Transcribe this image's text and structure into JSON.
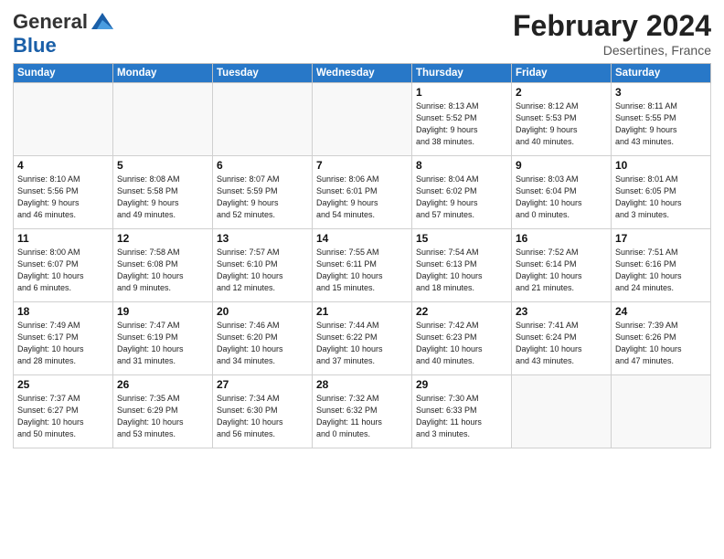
{
  "header": {
    "logo_general": "General",
    "logo_blue": "Blue",
    "month": "February 2024",
    "location": "Desertines, France"
  },
  "days_of_week": [
    "Sunday",
    "Monday",
    "Tuesday",
    "Wednesday",
    "Thursday",
    "Friday",
    "Saturday"
  ],
  "weeks": [
    [
      {
        "day": "",
        "info": ""
      },
      {
        "day": "",
        "info": ""
      },
      {
        "day": "",
        "info": ""
      },
      {
        "day": "",
        "info": ""
      },
      {
        "day": "1",
        "info": "Sunrise: 8:13 AM\nSunset: 5:52 PM\nDaylight: 9 hours\nand 38 minutes."
      },
      {
        "day": "2",
        "info": "Sunrise: 8:12 AM\nSunset: 5:53 PM\nDaylight: 9 hours\nand 40 minutes."
      },
      {
        "day": "3",
        "info": "Sunrise: 8:11 AM\nSunset: 5:55 PM\nDaylight: 9 hours\nand 43 minutes."
      }
    ],
    [
      {
        "day": "4",
        "info": "Sunrise: 8:10 AM\nSunset: 5:56 PM\nDaylight: 9 hours\nand 46 minutes."
      },
      {
        "day": "5",
        "info": "Sunrise: 8:08 AM\nSunset: 5:58 PM\nDaylight: 9 hours\nand 49 minutes."
      },
      {
        "day": "6",
        "info": "Sunrise: 8:07 AM\nSunset: 5:59 PM\nDaylight: 9 hours\nand 52 minutes."
      },
      {
        "day": "7",
        "info": "Sunrise: 8:06 AM\nSunset: 6:01 PM\nDaylight: 9 hours\nand 54 minutes."
      },
      {
        "day": "8",
        "info": "Sunrise: 8:04 AM\nSunset: 6:02 PM\nDaylight: 9 hours\nand 57 minutes."
      },
      {
        "day": "9",
        "info": "Sunrise: 8:03 AM\nSunset: 6:04 PM\nDaylight: 10 hours\nand 0 minutes."
      },
      {
        "day": "10",
        "info": "Sunrise: 8:01 AM\nSunset: 6:05 PM\nDaylight: 10 hours\nand 3 minutes."
      }
    ],
    [
      {
        "day": "11",
        "info": "Sunrise: 8:00 AM\nSunset: 6:07 PM\nDaylight: 10 hours\nand 6 minutes."
      },
      {
        "day": "12",
        "info": "Sunrise: 7:58 AM\nSunset: 6:08 PM\nDaylight: 10 hours\nand 9 minutes."
      },
      {
        "day": "13",
        "info": "Sunrise: 7:57 AM\nSunset: 6:10 PM\nDaylight: 10 hours\nand 12 minutes."
      },
      {
        "day": "14",
        "info": "Sunrise: 7:55 AM\nSunset: 6:11 PM\nDaylight: 10 hours\nand 15 minutes."
      },
      {
        "day": "15",
        "info": "Sunrise: 7:54 AM\nSunset: 6:13 PM\nDaylight: 10 hours\nand 18 minutes."
      },
      {
        "day": "16",
        "info": "Sunrise: 7:52 AM\nSunset: 6:14 PM\nDaylight: 10 hours\nand 21 minutes."
      },
      {
        "day": "17",
        "info": "Sunrise: 7:51 AM\nSunset: 6:16 PM\nDaylight: 10 hours\nand 24 minutes."
      }
    ],
    [
      {
        "day": "18",
        "info": "Sunrise: 7:49 AM\nSunset: 6:17 PM\nDaylight: 10 hours\nand 28 minutes."
      },
      {
        "day": "19",
        "info": "Sunrise: 7:47 AM\nSunset: 6:19 PM\nDaylight: 10 hours\nand 31 minutes."
      },
      {
        "day": "20",
        "info": "Sunrise: 7:46 AM\nSunset: 6:20 PM\nDaylight: 10 hours\nand 34 minutes."
      },
      {
        "day": "21",
        "info": "Sunrise: 7:44 AM\nSunset: 6:22 PM\nDaylight: 10 hours\nand 37 minutes."
      },
      {
        "day": "22",
        "info": "Sunrise: 7:42 AM\nSunset: 6:23 PM\nDaylight: 10 hours\nand 40 minutes."
      },
      {
        "day": "23",
        "info": "Sunrise: 7:41 AM\nSunset: 6:24 PM\nDaylight: 10 hours\nand 43 minutes."
      },
      {
        "day": "24",
        "info": "Sunrise: 7:39 AM\nSunset: 6:26 PM\nDaylight: 10 hours\nand 47 minutes."
      }
    ],
    [
      {
        "day": "25",
        "info": "Sunrise: 7:37 AM\nSunset: 6:27 PM\nDaylight: 10 hours\nand 50 minutes."
      },
      {
        "day": "26",
        "info": "Sunrise: 7:35 AM\nSunset: 6:29 PM\nDaylight: 10 hours\nand 53 minutes."
      },
      {
        "day": "27",
        "info": "Sunrise: 7:34 AM\nSunset: 6:30 PM\nDaylight: 10 hours\nand 56 minutes."
      },
      {
        "day": "28",
        "info": "Sunrise: 7:32 AM\nSunset: 6:32 PM\nDaylight: 11 hours\nand 0 minutes."
      },
      {
        "day": "29",
        "info": "Sunrise: 7:30 AM\nSunset: 6:33 PM\nDaylight: 11 hours\nand 3 minutes."
      },
      {
        "day": "",
        "info": ""
      },
      {
        "day": "",
        "info": ""
      }
    ]
  ]
}
